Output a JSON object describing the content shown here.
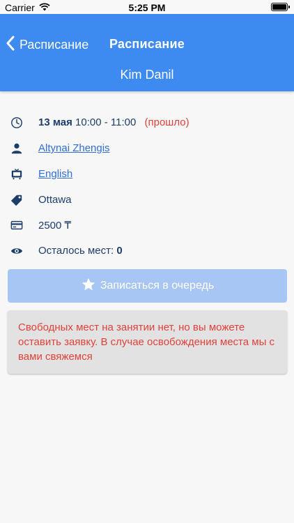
{
  "status_bar": {
    "carrier": "Carrier",
    "time": "5:25 PM"
  },
  "nav": {
    "back_label": "Расписание",
    "title": "Расписание",
    "subtitle": "Kim Danil"
  },
  "lesson": {
    "date": "13 мая",
    "time": "10:00 - 11:00",
    "state": "(прошло)",
    "teacher": "Altynai Zhengis",
    "subject": "English",
    "location": "Ottawa",
    "price": "2500 ₸",
    "seats_label": "Осталось мест:",
    "seats_value": "0"
  },
  "queue_button": {
    "label": "Записаться в очередь",
    "icon": "star-icon"
  },
  "notice": {
    "text": "Свободных мест на занятии нет, но вы можете оставить заявку. В случае освобождения места мы с вами свяжемся"
  },
  "colors": {
    "accent": "#3d8af0",
    "disabled_button": "#a8c6f4",
    "text": "#1d3d6b",
    "link": "#2f6fd6",
    "warning": "#e0413a"
  },
  "icons": [
    "clock-icon",
    "person-icon",
    "tv-icon",
    "tag-icon",
    "card-icon",
    "eye-icon"
  ]
}
